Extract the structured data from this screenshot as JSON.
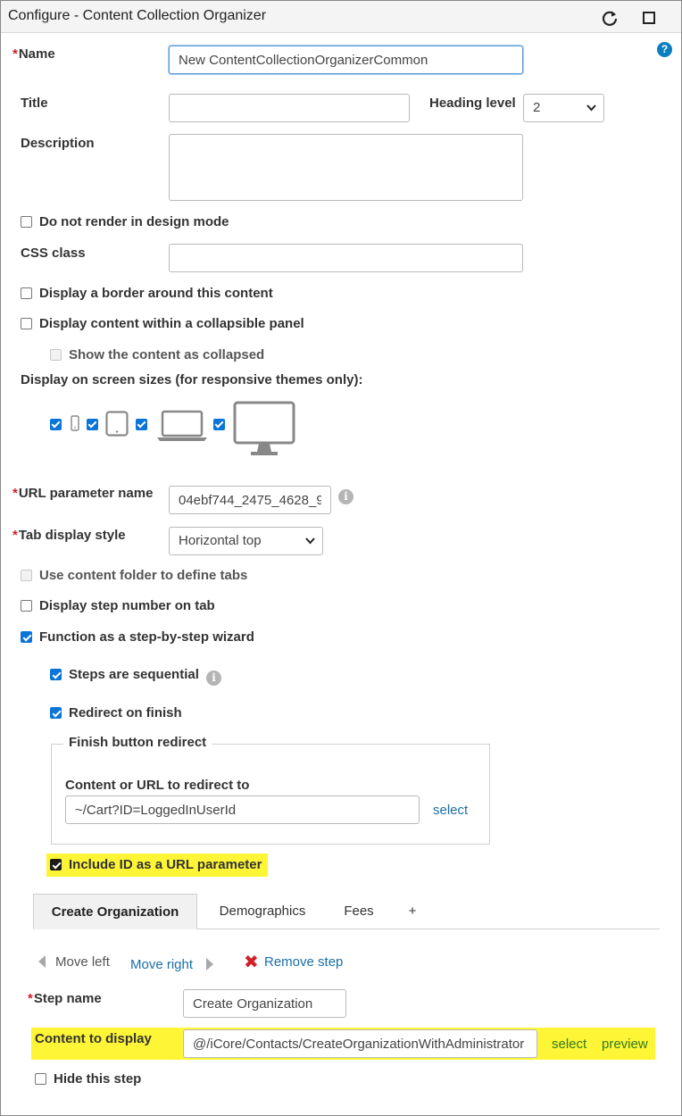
{
  "window": {
    "title": "Configure - Content Collection Organizer"
  },
  "icons": {
    "refresh": "refresh-icon",
    "maximize": "maximize-icon",
    "help": "?"
  },
  "name": {
    "label": "Name",
    "value": "New ContentCollectionOrganizerCommon"
  },
  "title_field": {
    "label": "Title",
    "value": ""
  },
  "heading_level": {
    "label": "Heading level",
    "value": "2"
  },
  "description": {
    "label": "Description",
    "value": ""
  },
  "do_not_render": {
    "label": "Do not render in design mode",
    "checked": false
  },
  "css_class": {
    "label": "CSS class",
    "value": ""
  },
  "display_border": {
    "label": "Display a border around this content",
    "checked": false
  },
  "collapsible_panel": {
    "label": "Display content within a collapsible panel",
    "checked": false
  },
  "show_collapsed": {
    "label": "Show the content as collapsed",
    "checked": false,
    "disabled": true
  },
  "screen_sizes": {
    "label": "Display on screen sizes (for responsive themes only):",
    "devices": [
      {
        "name": "phone",
        "checked": true
      },
      {
        "name": "tablet",
        "checked": true
      },
      {
        "name": "laptop",
        "checked": true
      },
      {
        "name": "desktop",
        "checked": true
      }
    ]
  },
  "url_param": {
    "label": "URL parameter name",
    "value": "04ebf744_2475_4628_9"
  },
  "tab_style": {
    "label": "Tab display style",
    "value": "Horizontal top"
  },
  "use_content_folder": {
    "label": "Use content folder to define tabs",
    "checked": false,
    "disabled": true
  },
  "display_step_number": {
    "label": "Display step number on tab",
    "checked": false
  },
  "step_wizard": {
    "label": "Function as a step-by-step wizard",
    "checked": true
  },
  "steps_sequential": {
    "label": "Steps are sequential",
    "checked": true
  },
  "redirect_finish": {
    "label": "Redirect on finish",
    "checked": true
  },
  "finish_redirect": {
    "legend": "Finish button redirect",
    "field_label": "Content or URL to redirect to",
    "value": "~/Cart?ID=LoggedInUserId",
    "select_label": "select"
  },
  "include_id": {
    "label": "Include ID as a URL parameter",
    "checked": true
  },
  "tabs": [
    {
      "label": "Create Organization",
      "active": true
    },
    {
      "label": "Demographics",
      "active": false
    },
    {
      "label": "Fees",
      "active": false
    },
    {
      "label": "+",
      "active": false
    }
  ],
  "step_actions": {
    "move_left": "Move left",
    "move_right": "Move right",
    "remove_step": "Remove step"
  },
  "step_name": {
    "label": "Step name",
    "value": "Create Organization"
  },
  "content_display": {
    "label": "Content to display",
    "value": "@/iCore/Contacts/CreateOrganizationWithAdministrator",
    "select_label": "select",
    "preview_label": "preview"
  },
  "hide_step": {
    "label": "Hide this step",
    "checked": false
  },
  "colors": {
    "accent": "#0a75d8",
    "link": "#1a6fa8",
    "highlight": "#fdf535",
    "required": "#d0202a"
  }
}
